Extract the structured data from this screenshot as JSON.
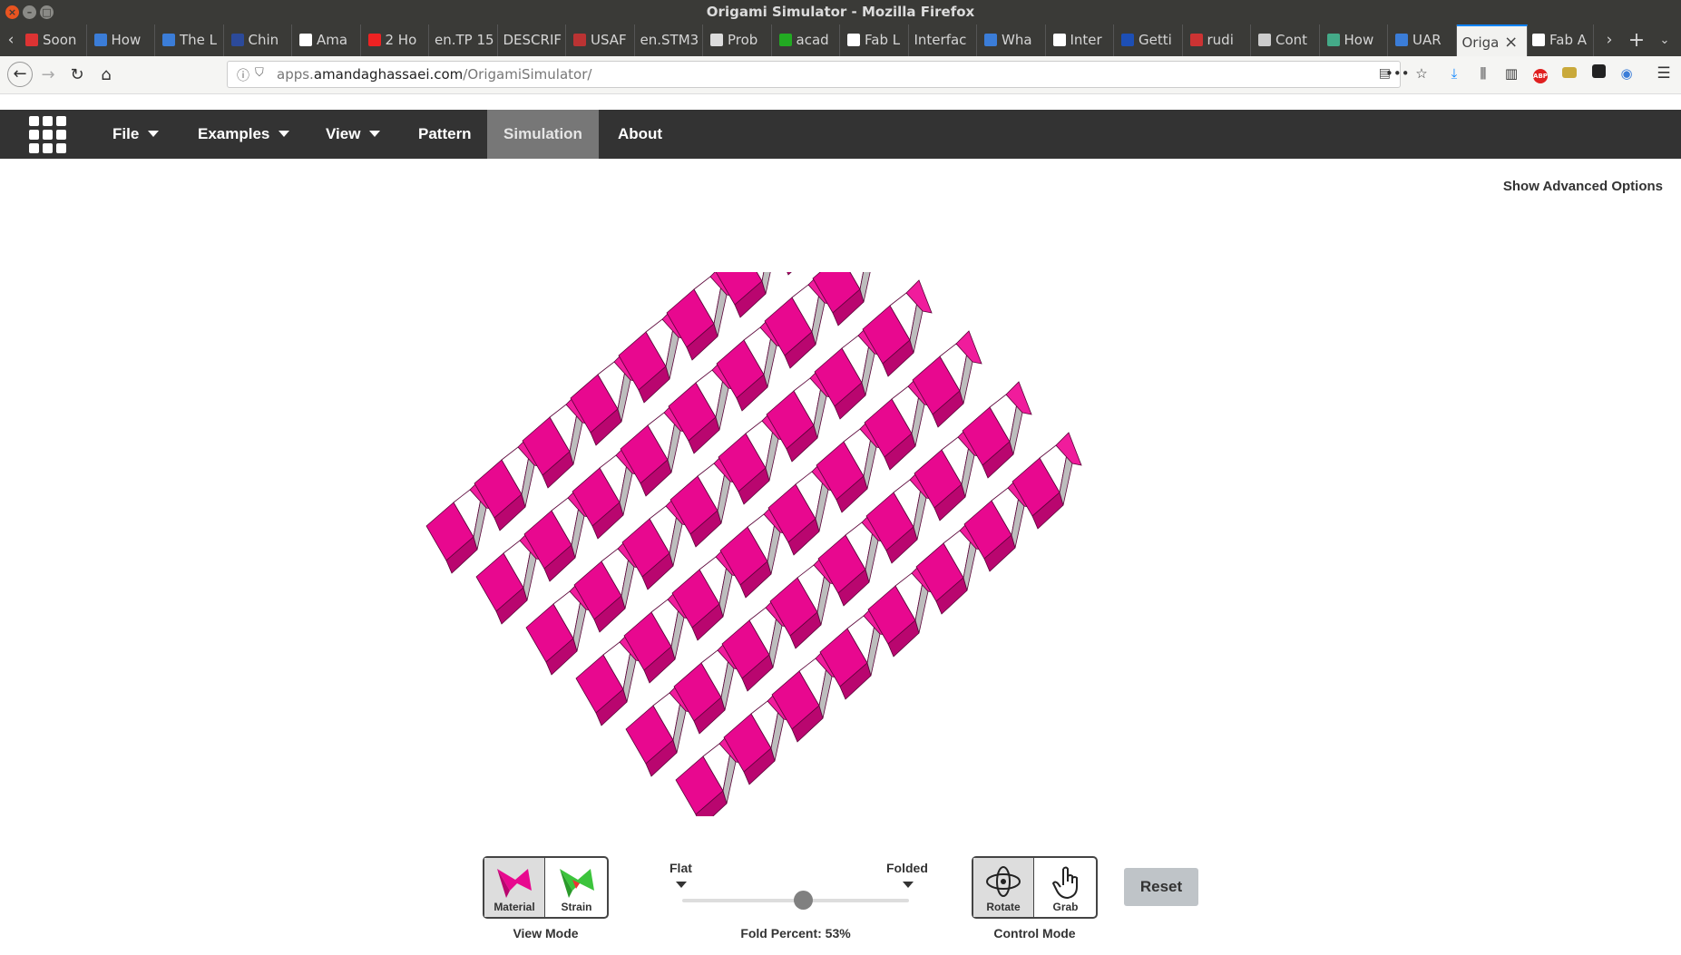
{
  "window": {
    "title": "Origami Simulator - Mozilla Firefox"
  },
  "tabs": [
    {
      "label": "Soon",
      "fav_color": "#d33"
    },
    {
      "label": "How",
      "fav_color": "#3b7dd8"
    },
    {
      "label": "The L",
      "fav_color": "#3b7dd8"
    },
    {
      "label": "Chin",
      "fav_color": "#2c4a9a"
    },
    {
      "label": "Ama",
      "fav_color": "#fff"
    },
    {
      "label": "2 Ho",
      "fav_color": "#e22"
    },
    {
      "label": "en.TP 15",
      "fav_color": ""
    },
    {
      "label": "DESCRIF",
      "fav_color": ""
    },
    {
      "label": "USAF",
      "fav_color": "#b33"
    },
    {
      "label": "en.STM3",
      "fav_color": ""
    },
    {
      "label": "Prob",
      "fav_color": "#ddd"
    },
    {
      "label": "acad",
      "fav_color": "#2a2"
    },
    {
      "label": "Fab L",
      "fav_color": "#fff"
    },
    {
      "label": "Interfac",
      "fav_color": ""
    },
    {
      "label": "Wha",
      "fav_color": "#3b7dd8"
    },
    {
      "label": "Inter",
      "fav_color": "#fff"
    },
    {
      "label": "Getti",
      "fav_color": "#1d4fb5"
    },
    {
      "label": "rudi",
      "fav_color": "#c33"
    },
    {
      "label": "Cont",
      "fav_color": "#ccc"
    },
    {
      "label": "How",
      "fav_color": "#4a8"
    },
    {
      "label": "UAR",
      "fav_color": "#3b7dd8"
    },
    {
      "label": "Origa",
      "fav_color": ""
    },
    {
      "label": "Fab A",
      "fav_color": "#fff"
    }
  ],
  "address": {
    "prefix": "apps.",
    "domain": "amandaghassaei.com",
    "path": "/OrigamiSimulator/"
  },
  "app": {
    "menu": {
      "file": "File",
      "examples": "Examples",
      "view": "View",
      "pattern": "Pattern",
      "simulation": "Simulation",
      "about": "About"
    },
    "advanced": "Show Advanced Options",
    "view_mode": {
      "label": "View Mode",
      "material": "Material",
      "strain": "Strain"
    },
    "fold": {
      "flat": "Flat",
      "folded": "Folded",
      "percent_label": "Fold Percent: 53%",
      "percent": 53
    },
    "control_mode": {
      "label": "Control Mode",
      "rotate": "Rotate",
      "grab": "Grab"
    },
    "reset": "Reset"
  },
  "colors": {
    "paper": "#e8088f",
    "paper_dark": "#b9066f",
    "paper_light": "#f01c9c",
    "nav_bg": "#333333",
    "active_menu": "#777777"
  }
}
